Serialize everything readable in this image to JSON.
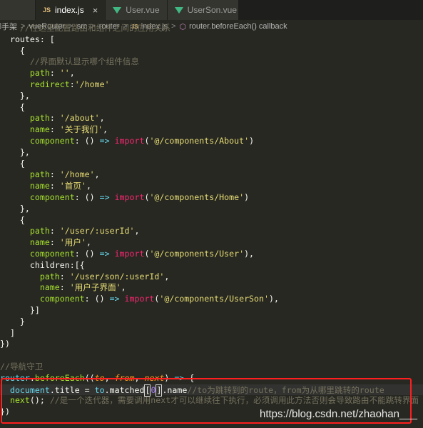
{
  "tabs": [
    {
      "badge": "",
      "label": "",
      "active": false
    },
    {
      "badge": "JS",
      "label": "index.js",
      "active": true,
      "close": "×"
    },
    {
      "badge": "vue",
      "label": "User.vue",
      "active": false
    },
    {
      "badge": "vue",
      "label": "UserSon.vue",
      "active": false
    }
  ],
  "breadcrumb": {
    "items": [
      "脚手架",
      "vueRouter",
      "src",
      "router",
      "index.js",
      "router.beforeEach() callback"
    ],
    "separator": ">"
  },
  "code": {
    "lines": {
      "l0": "//在这里配置路由和组件之间的应用关系",
      "l1": "routes: [",
      "l2": "{",
      "l3": "//界面默认显示哪个组件信息",
      "l4a": "path",
      "l4b": "''",
      "l5a": "redirect",
      "l5b": "'/home'",
      "l6": "},",
      "l7": "{",
      "l8a": "path",
      "l8b": "'/about'",
      "l9a": "name",
      "l9b": "'关于我们'",
      "l10a": "component",
      "l10b": "import",
      "l10c": "'@/components/About'",
      "l11": "},",
      "l12": "{",
      "l13a": "path",
      "l13b": "'/home'",
      "l14a": "name",
      "l14b": "'首页'",
      "l15a": "component",
      "l15b": "import",
      "l15c": "'@/components/Home'",
      "l16": "},",
      "l17": "{",
      "l18a": "path",
      "l18b": "'/user/:userId'",
      "l19a": "name",
      "l19b": "'用户'",
      "l20a": "component",
      "l20b": "import",
      "l20c": "'@/components/User'",
      "l21": "children:[{",
      "l22a": "path",
      "l22b": "'/user/son/:userId'",
      "l23a": "name",
      "l23b": "'用户子界面'",
      "l24a": "component",
      "l24b": "import",
      "l24c": "'@/components/UserSon'",
      "l25": "}]",
      "l26": "}",
      "l27": "]",
      "l28": "})",
      "l29": "",
      "l30": "//导航守卫",
      "l31a": "router",
      "l31b": "beforeEach",
      "l31c": "to",
      "l31d": "from",
      "l31e": "next",
      "l32a": "document",
      "l32b": "title",
      "l32c": "to",
      "l32d": "matched",
      "l32e": "0",
      "l32f": "name",
      "l32g": "//to为跳转到的route，from为从哪里跳转的route",
      "l33a": "next",
      "l33b": "//是一个迭代器，需要调用next才可以继续往下执行，必须调用此方法否则会导致路由不能跳转界面",
      "l34": "})"
    }
  },
  "watermark": "https://blog.csdn.net/zhaohan___"
}
